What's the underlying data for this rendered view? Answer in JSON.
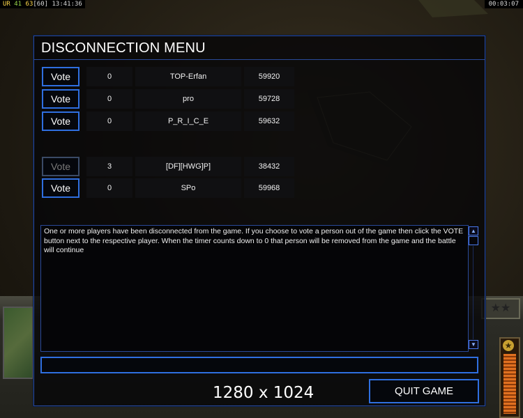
{
  "hud": {
    "top_left": {
      "ur": "UR",
      "fps_a": "41",
      "fps_b": "63",
      "fps_cap": "[60]",
      "clock": "13:41:36"
    },
    "top_right": {
      "timer": "00:03:07"
    }
  },
  "dialog": {
    "title": "DISCONNECTION MENU",
    "players": [
      {
        "vote_label": "Vote",
        "enabled": true,
        "count": "0",
        "name": "TOP-Erfan",
        "ping": "59920"
      },
      {
        "vote_label": "Vote",
        "enabled": true,
        "count": "0",
        "name": "pro",
        "ping": "59728"
      },
      {
        "vote_label": "Vote",
        "enabled": true,
        "count": "0",
        "name": "P_R_I_C_E",
        "ping": "59632"
      },
      {
        "vote_label": "Vote",
        "enabled": false,
        "count": "3",
        "name": "[DF][HWG]P]",
        "ping": "38432"
      },
      {
        "vote_label": "Vote",
        "enabled": true,
        "count": "0",
        "name": "SPo",
        "ping": "59968"
      }
    ],
    "message": "One or more players have been disconnected from the game. If you choose to vote a person out of the game then click the VOTE button next to the respective player. When the timer counts down to 0 that person will be removed from the game and the battle will continue",
    "chat_value": "",
    "quit_label": "QUIT GAME"
  },
  "resolution_label": "1280 x 1024",
  "colors": {
    "accent": "#2f6fe0",
    "border": "#2a4a9a"
  }
}
